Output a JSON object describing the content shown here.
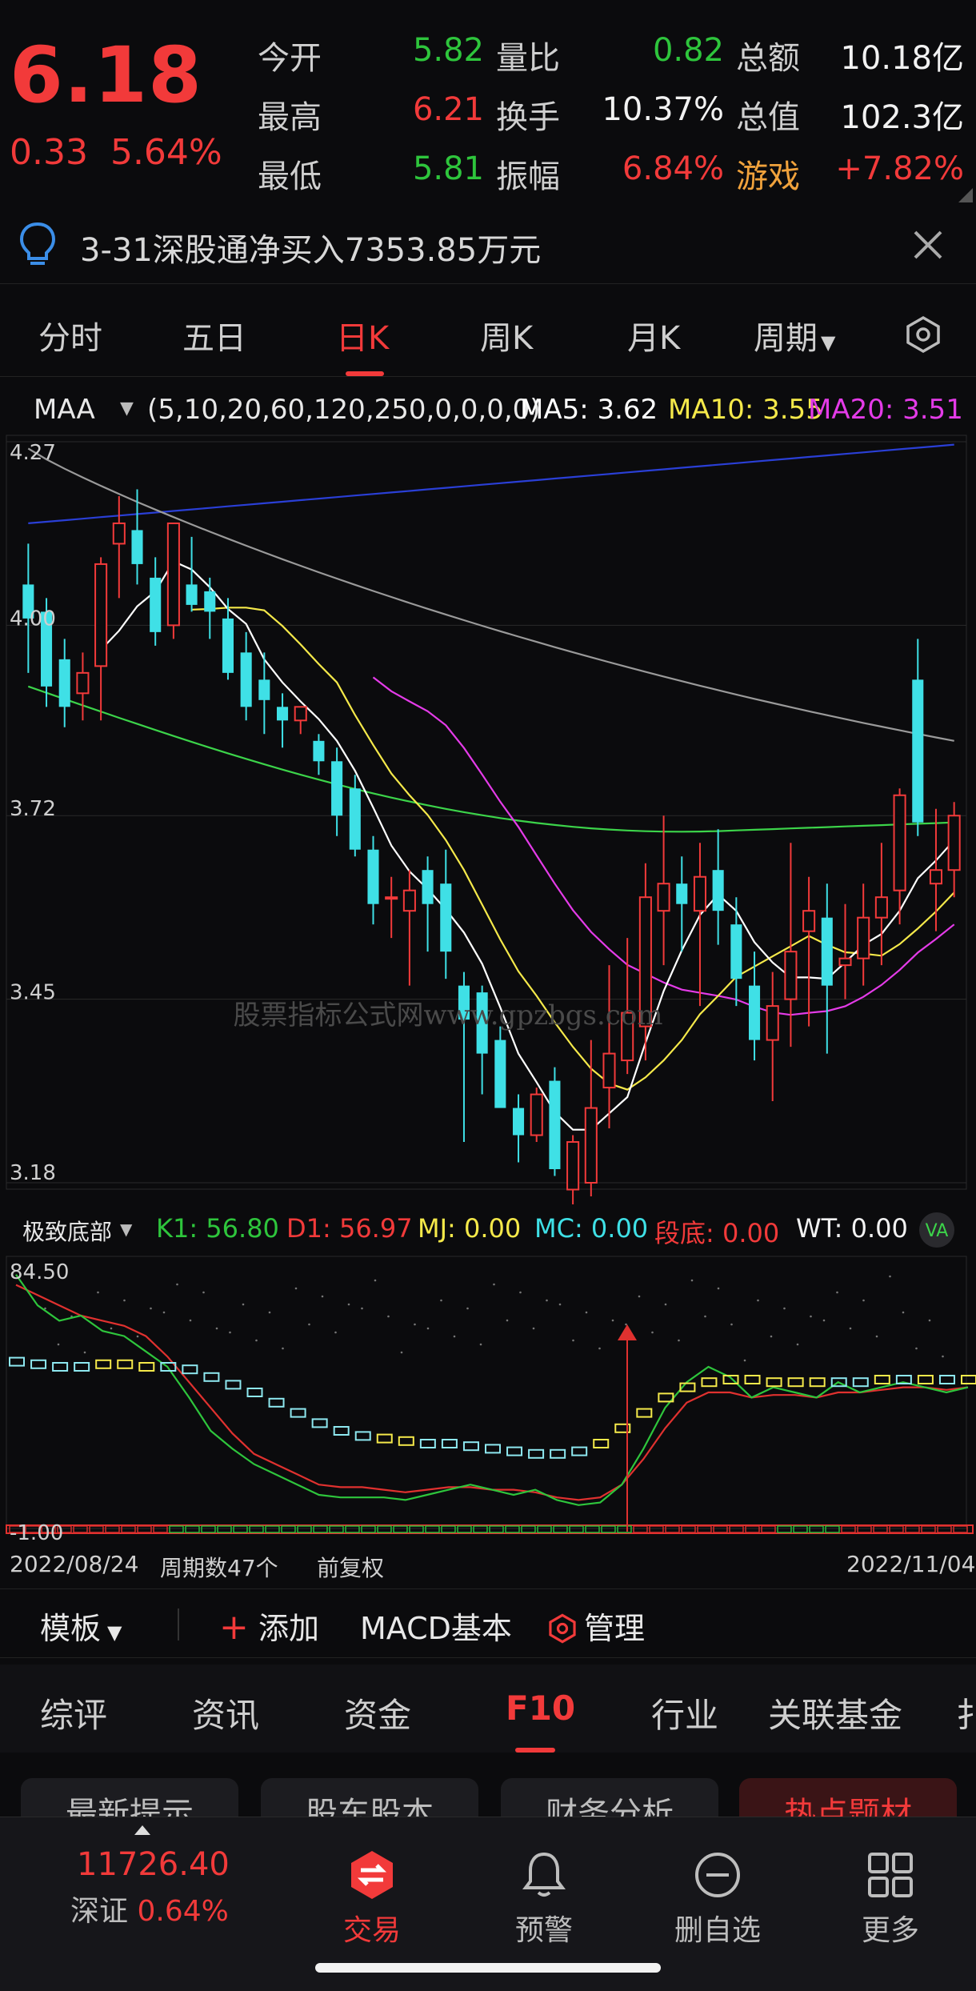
{
  "quote": {
    "price": "6.18",
    "change": "0.33",
    "change_pct": "5.64%",
    "rows": [
      {
        "l1": "今开",
        "v1": "5.82",
        "l2": "量比",
        "v2": "0.82",
        "l3": "总额",
        "v3": "10.18亿"
      },
      {
        "l1": "最高",
        "v1": "6.21",
        "l2": "换手",
        "v2": "10.37%",
        "l3": "总值",
        "v3": "102.3亿"
      },
      {
        "l1": "最低",
        "v1": "5.81",
        "l2": "振幅",
        "v2": "6.84%",
        "l3": "游戏",
        "v3": "+7.82%"
      }
    ]
  },
  "notice": {
    "text": "3-31深股通净买入7353.85万元"
  },
  "period_tabs": [
    "分时",
    "五日",
    "日K",
    "周K",
    "月K",
    "周期"
  ],
  "active_tab": "日K",
  "ma_legend": {
    "name": "MAA",
    "params": "(5,10,20,60,120,250,0,0,0,0)",
    "ma5": "MA5: 3.62",
    "ma10": "MA10: 3.55",
    "ma20": "MA20: 3.51"
  },
  "price_axis": [
    "4.27",
    "4.00",
    "3.72",
    "3.45",
    "3.18"
  ],
  "watermark": "股票指标公式网www.gpzbgs.com",
  "indicator_legend": {
    "name": "极致底部",
    "k1": "K1: 56.80",
    "d1": "D1: 56.97",
    "mj": "MJ: 0.00",
    "mc": "MC: 0.00",
    "dd": "段底: 0.00",
    "wt": "WT: 0.00"
  },
  "indicator_axis": [
    "84.50",
    "-1.00"
  ],
  "time_axis": {
    "start": "2022/08/24",
    "count": "周期数47个",
    "adjust": "前复权",
    "end": "2022/11/04"
  },
  "tools": {
    "template": "模板",
    "add": "添加",
    "macd": "MACD基本",
    "manage": "管理"
  },
  "main_tabs": [
    "综评",
    "资讯",
    "资金",
    "F10",
    "行业",
    "关联基金",
    "扌"
  ],
  "main_active": "F10",
  "sub_buttons": [
    "最新提示",
    "股东股本",
    "财务分析",
    "热点题材"
  ],
  "bottom": {
    "index_value": "11726.40",
    "index_name": "深证",
    "index_pct": "0.64%",
    "nav": [
      "交易",
      "预警",
      "删自选",
      "更多"
    ]
  },
  "colors": {
    "up": "#f23a3a",
    "down": "#3fe0e6",
    "ma5": "#ffffff",
    "ma10": "#f5e94a",
    "ma20": "#e43be8",
    "ma60": "#3cd44a",
    "ma120": "#9a9a9a",
    "ma250": "#2a3fd6"
  },
  "chart_data": {
    "type": "candlestick",
    "candles": [
      [
        4.06,
        4.12,
        3.93,
        4.01
      ],
      [
        4.02,
        4.04,
        3.88,
        3.91
      ],
      [
        3.95,
        3.98,
        3.85,
        3.88
      ],
      [
        3.9,
        3.96,
        3.86,
        3.93
      ],
      [
        3.94,
        4.1,
        3.86,
        4.09
      ],
      [
        4.12,
        4.19,
        4.04,
        4.15
      ],
      [
        4.14,
        4.2,
        4.06,
        4.09
      ],
      [
        4.07,
        4.1,
        3.97,
        3.99
      ],
      [
        4.0,
        4.15,
        3.98,
        4.15
      ],
      [
        4.06,
        4.13,
        4.02,
        4.03
      ],
      [
        4.05,
        4.07,
        3.98,
        4.02
      ],
      [
        4.01,
        4.04,
        3.92,
        3.93
      ],
      [
        3.96,
        3.99,
        3.86,
        3.88
      ],
      [
        3.92,
        3.96,
        3.84,
        3.89
      ],
      [
        3.88,
        3.9,
        3.82,
        3.86
      ],
      [
        3.86,
        3.88,
        3.84,
        3.88
      ],
      [
        3.83,
        3.84,
        3.78,
        3.8
      ],
      [
        3.8,
        3.82,
        3.69,
        3.72
      ],
      [
        3.76,
        3.78,
        3.66,
        3.67
      ],
      [
        3.67,
        3.69,
        3.56,
        3.59
      ],
      [
        3.6,
        3.63,
        3.54,
        3.6
      ],
      [
        3.58,
        3.64,
        3.47,
        3.61
      ],
      [
        3.64,
        3.66,
        3.52,
        3.59
      ],
      [
        3.62,
        3.67,
        3.48,
        3.52
      ],
      [
        3.47,
        3.49,
        3.24,
        3.42
      ],
      [
        3.46,
        3.47,
        3.31,
        3.37
      ],
      [
        3.39,
        3.41,
        3.29,
        3.29
      ],
      [
        3.29,
        3.31,
        3.21,
        3.25
      ],
      [
        3.25,
        3.32,
        3.24,
        3.31
      ],
      [
        3.33,
        3.35,
        3.19,
        3.2
      ],
      [
        3.17,
        3.25,
        3.14,
        3.24
      ],
      [
        3.18,
        3.39,
        3.16,
        3.29
      ],
      [
        3.32,
        3.5,
        3.26,
        3.37
      ],
      [
        3.36,
        3.54,
        3.34,
        3.43
      ],
      [
        3.41,
        3.65,
        3.36,
        3.6
      ],
      [
        3.58,
        3.72,
        3.5,
        3.62
      ],
      [
        3.62,
        3.66,
        3.52,
        3.59
      ],
      [
        3.58,
        3.68,
        3.44,
        3.63
      ],
      [
        3.64,
        3.7,
        3.53,
        3.58
      ],
      [
        3.56,
        3.6,
        3.44,
        3.48
      ],
      [
        3.47,
        3.52,
        3.36,
        3.39
      ],
      [
        3.39,
        3.49,
        3.3,
        3.44
      ],
      [
        3.45,
        3.68,
        3.38,
        3.52
      ],
      [
        3.55,
        3.63,
        3.41,
        3.58
      ],
      [
        3.57,
        3.62,
        3.37,
        3.47
      ],
      [
        3.5,
        3.59,
        3.45,
        3.51
      ],
      [
        3.51,
        3.62,
        3.47,
        3.57
      ],
      [
        3.57,
        3.68,
        3.5,
        3.6
      ],
      [
        3.61,
        3.76,
        3.56,
        3.75
      ],
      [
        3.92,
        3.98,
        3.69,
        3.71
      ],
      [
        3.62,
        3.73,
        3.55,
        3.64
      ],
      [
        3.64,
        3.74,
        3.6,
        3.72
      ]
    ],
    "ylim": [
      3.18,
      4.27
    ]
  }
}
